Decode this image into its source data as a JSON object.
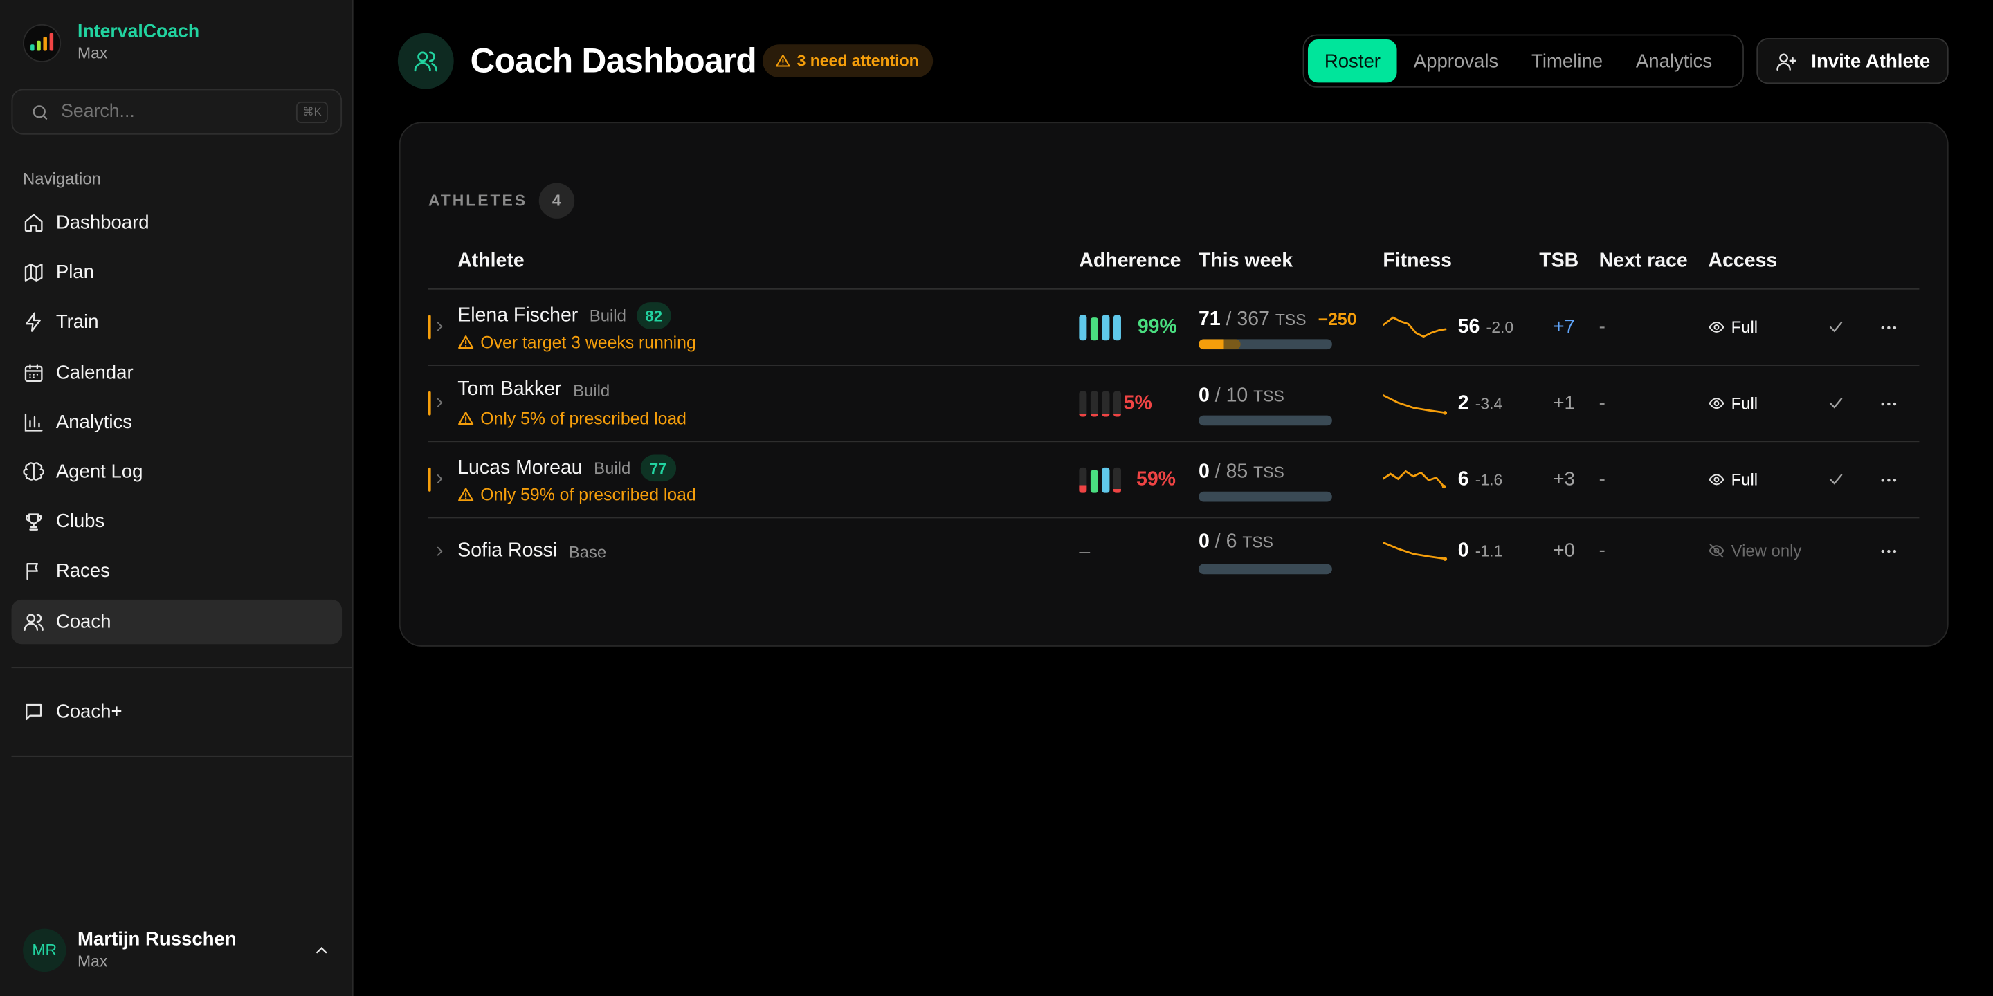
{
  "app": {
    "name": "IntervalCoach",
    "workspace": "Max"
  },
  "search": {
    "placeholder": "Search...",
    "shortcut": "⌘K"
  },
  "sidebar": {
    "heading": "Navigation",
    "items": [
      {
        "label": "Dashboard",
        "icon": "home-icon"
      },
      {
        "label": "Plan",
        "icon": "map-icon"
      },
      {
        "label": "Train",
        "icon": "zap-icon"
      },
      {
        "label": "Calendar",
        "icon": "calendar-icon"
      },
      {
        "label": "Analytics",
        "icon": "bar-chart-icon"
      },
      {
        "label": "Agent Log",
        "icon": "brain-icon"
      },
      {
        "label": "Clubs",
        "icon": "trophy-icon"
      },
      {
        "label": "Races",
        "icon": "flag-icon"
      },
      {
        "label": "Coach",
        "icon": "users-icon",
        "active": true
      }
    ],
    "secondary": [
      {
        "label": "Coach+",
        "icon": "message-icon"
      }
    ]
  },
  "user": {
    "initials": "MR",
    "name": "Martijn Russchen",
    "workspace": "Max"
  },
  "header": {
    "title": "Coach Dashboard",
    "attention_badge": "3 need attention",
    "tabs": [
      "Roster",
      "Approvals",
      "Timeline",
      "Analytics"
    ],
    "active_tab": "Roster",
    "invite_label": "Invite Athlete"
  },
  "roster": {
    "section_label": "ATHLETES",
    "count": "4",
    "columns": [
      "Athlete",
      "Adherence",
      "This week",
      "Fitness",
      "TSB",
      "Next race",
      "Access"
    ],
    "rows": [
      {
        "name": "Elena Fischer",
        "phase": "Build",
        "score": "82",
        "flagged": true,
        "warning": "Over target 3 weeks running",
        "adherence": "99%",
        "adherence_color": "#4ade80",
        "week_done": "71",
        "week_planned": "/ 367",
        "unit": "TSS",
        "week_delta": "−250",
        "week_progress": 0.31,
        "fitness": "56",
        "fitness_delta": "-2.0",
        "tsb": "+7",
        "tsb_color": "#60a5fa",
        "next_race": "-",
        "access": "Full",
        "access_icon": "eye-icon",
        "approved": true
      },
      {
        "name": "Tom Bakker",
        "phase": "Build",
        "score": "",
        "flagged": true,
        "warning": "Only 5% of prescribed load",
        "adherence": "5%",
        "adherence_color": "#ef4444",
        "week_done": "0",
        "week_planned": "/ 10",
        "unit": "TSS",
        "week_delta": "",
        "week_progress": 0,
        "fitness": "2",
        "fitness_delta": "-3.4",
        "tsb": "+1",
        "tsb_color": "#a3a3a3",
        "next_race": "-",
        "access": "Full",
        "access_icon": "eye-icon",
        "approved": true
      },
      {
        "name": "Lucas Moreau",
        "phase": "Build",
        "score": "77",
        "flagged": true,
        "warning": "Only 59% of prescribed load",
        "adherence": "59%",
        "adherence_color": "#ef4444",
        "week_done": "0",
        "week_planned": "/ 85",
        "unit": "TSS",
        "week_delta": "",
        "week_progress": 0,
        "fitness": "6",
        "fitness_delta": "-1.6",
        "tsb": "+3",
        "tsb_color": "#a3a3a3",
        "next_race": "-",
        "access": "Full",
        "access_icon": "eye-icon",
        "approved": true
      },
      {
        "name": "Sofia Rossi",
        "phase": "Base",
        "score": "",
        "flagged": false,
        "warning": "",
        "adherence": "–",
        "adherence_color": "#8f8f8f",
        "week_done": "0",
        "week_planned": "/ 6",
        "unit": "TSS",
        "week_delta": "",
        "week_progress": 0,
        "fitness": "0",
        "fitness_delta": "-1.1",
        "tsb": "+0",
        "tsb_color": "#a3a3a3",
        "next_race": "-",
        "access": "View only",
        "access_icon": "eye-off-icon",
        "approved": false
      }
    ]
  },
  "colors": {
    "accent": "#00e59b",
    "warning": "#f59e0b",
    "danger": "#ef4444",
    "success": "#4ade80"
  }
}
